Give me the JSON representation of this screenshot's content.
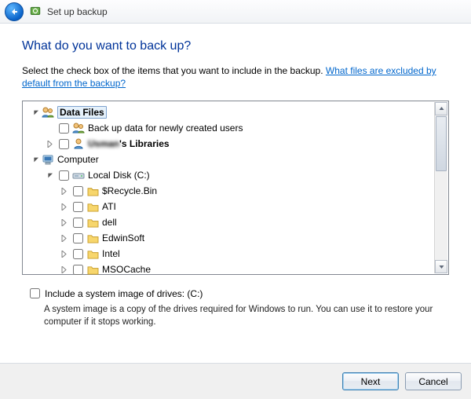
{
  "window": {
    "title": "Set up backup"
  },
  "heading": "What do you want to back up?",
  "intro": {
    "text": "Select the check box of the items that you want to include in the backup. ",
    "link": "What files are excluded by default from the backup?"
  },
  "tree": {
    "dataFiles": {
      "label": "Data Files",
      "newUsers": "Back up data for newly created users",
      "userLibs": "'s Libraries",
      "userLibsPrefixBlurred": "Usman"
    },
    "computer": {
      "label": "Computer",
      "localDisk": "Local Disk (C:)",
      "folders": [
        "$Recycle.Bin",
        "ATI",
        "dell",
        "EdwinSoft",
        "Intel",
        "MSOCache"
      ]
    }
  },
  "systemImage": {
    "checkboxLabel": "Include a system image of drives: (C:)",
    "description": "A system image is a copy of the drives required for Windows to run. You can use it to restore your computer if it stops working."
  },
  "buttons": {
    "next": "Next",
    "cancel": "Cancel"
  }
}
